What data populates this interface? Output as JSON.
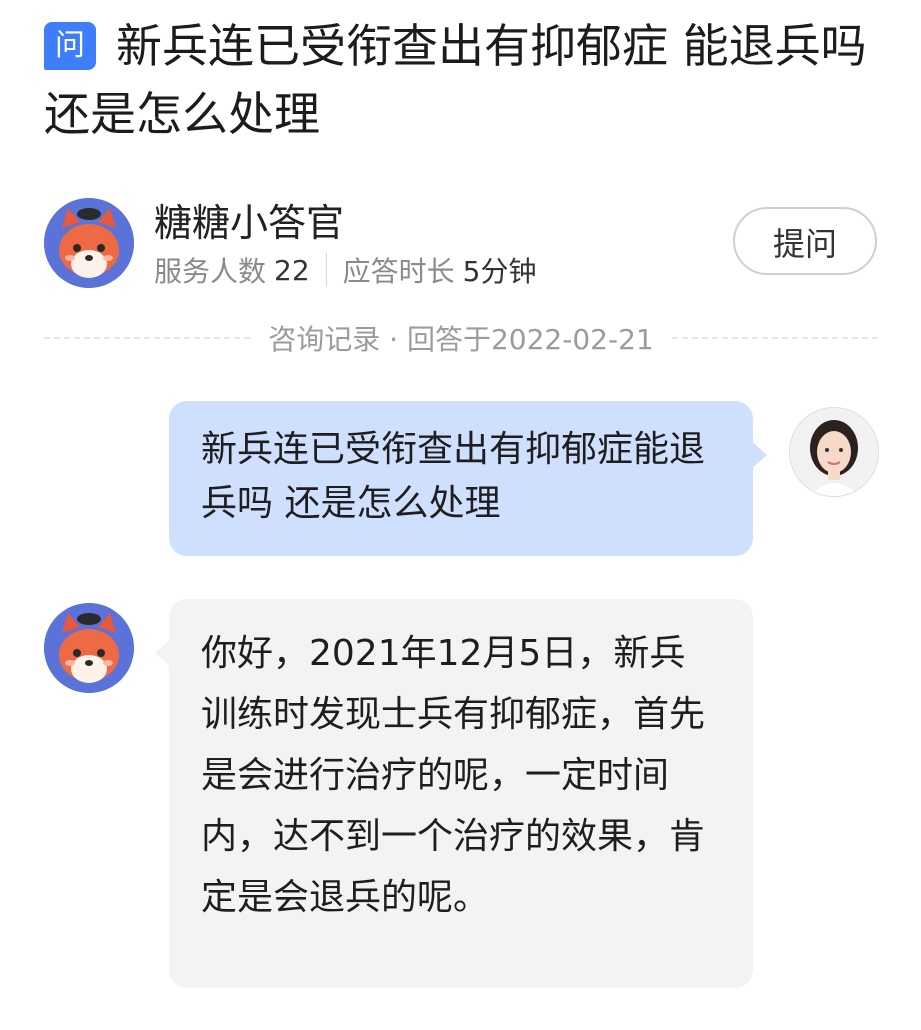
{
  "question": {
    "badge": "问",
    "title": "新兵连已受衔查出有抑郁症 能退兵吗 还是怎么处理"
  },
  "expert": {
    "name": "糖糖小答官",
    "served_label": "服务人数",
    "served_count": "22",
    "response_label": "应答时长",
    "response_time": "5分钟",
    "ask_button": "提问",
    "avatar_icon": "fox-mascot-icon"
  },
  "record": {
    "divider_text": "咨询记录 · 回答于2022-02-21"
  },
  "chat": {
    "user_message": "新兵连已受衔查出有抑郁症能退兵吗 还是怎么处理",
    "user_avatar_icon": "user-photo-avatar",
    "answer_message": "你好，2021年12月5日，新兵训练时发现士兵有抑郁症，首先是会进行治疗的呢，一定时间内，达不到一个治疗的效果，肯定是会退兵的呢。"
  },
  "colors": {
    "badge": "#3e7dfb",
    "user_bubble": "#cfe0ff",
    "answer_bubble": "#f3f3f3"
  }
}
